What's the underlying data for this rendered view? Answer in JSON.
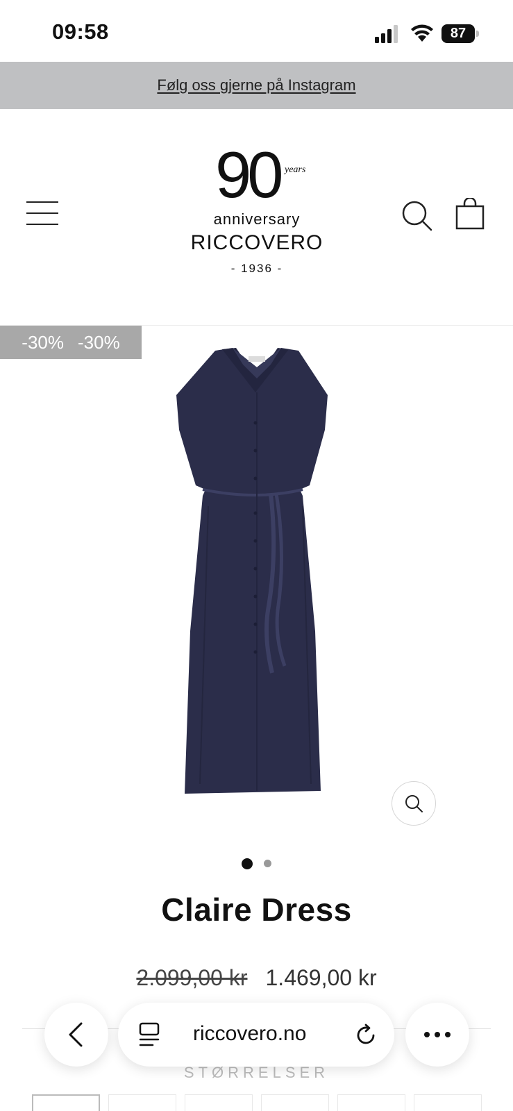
{
  "status_bar": {
    "time": "09:58",
    "battery": "87"
  },
  "announcement": {
    "text": "Følg oss gjerne på Instagram"
  },
  "header": {
    "logo": {
      "number": "90",
      "years": "years",
      "anniversary": "anniversary",
      "brand": "RICCOVERO",
      "founded": "- 1936 -"
    }
  },
  "product": {
    "badges": [
      "-30%",
      "-30%"
    ],
    "image_icon": "navy-shirt-dress",
    "image_count": 2,
    "active_image": 1,
    "title": "Claire Dress",
    "price_old": "2.099,00 kr",
    "price_new": "1.469,00 kr",
    "sizes_label": "STØRRELSER"
  },
  "browser": {
    "url": "riccovero.no"
  },
  "colors": {
    "announcement_bg": "#bfc0c2",
    "badge_bg": "#a8a8a8",
    "dress": "#2b2d4a"
  }
}
